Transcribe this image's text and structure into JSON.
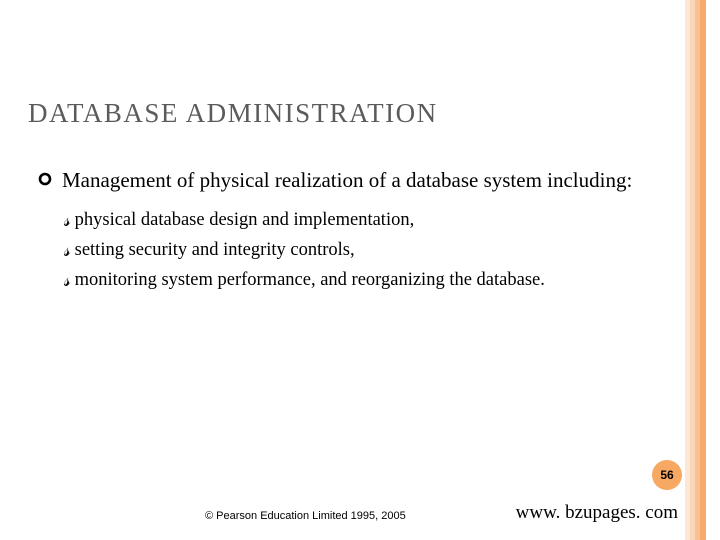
{
  "title": "DATABASE ADMINISTRATION",
  "main_bullet": "Management of physical realization of a database system including:",
  "sub_bullets": [
    "physical database design and implementation,",
    "setting security and integrity controls,",
    "monitoring system performance, and reorganizing the database."
  ],
  "page_number": "56",
  "copyright": "© Pearson Education Limited 1995, 2005",
  "url": "www. bzupages. com"
}
